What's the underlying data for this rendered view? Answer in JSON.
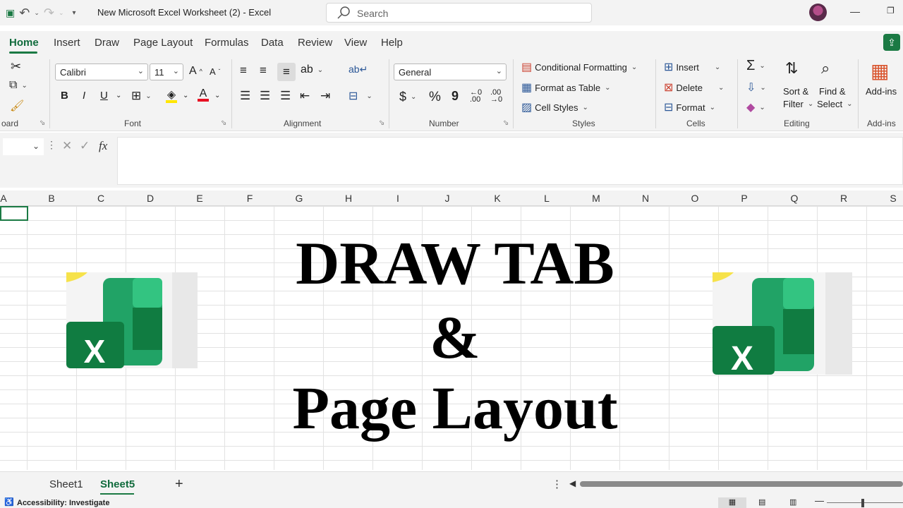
{
  "title_bar": {
    "document_title": "New Microsoft Excel Worksheet (2)  -  Excel",
    "search_placeholder": "Search",
    "undo_icon": "undo-icon",
    "redo_icon": "redo-icon"
  },
  "menu": {
    "tabs": [
      "Home",
      "Insert",
      "Draw",
      "Page Layout",
      "Formulas",
      "Data",
      "Review",
      "View",
      "Help"
    ],
    "active": "Home"
  },
  "ribbon": {
    "clipboard_label": "oard",
    "font": {
      "label": "Font",
      "font_name": "Calibri",
      "font_size": "11",
      "bold": "B",
      "italic": "I",
      "underline": "U"
    },
    "alignment_label": "Alignment",
    "number": {
      "label": "Number",
      "format": "General",
      "currency": "$",
      "percent": "%",
      "comma": "9"
    },
    "styles": {
      "label": "Styles",
      "conditional_formatting": "Conditional Formatting",
      "format_as_table": "Format as Table",
      "cell_styles": "Cell Styles"
    },
    "cells": {
      "label": "Cells",
      "insert": "Insert",
      "delete": "Delete",
      "format": "Format"
    },
    "editing": {
      "label": "Editing",
      "sort_filter_1": "Sort &",
      "sort_filter_2": "Filter",
      "find_select_1": "Find &",
      "find_select_2": "Select"
    },
    "addins": {
      "label": "Add-ins",
      "button": "Add-ins"
    }
  },
  "formula_bar": {
    "fx": "fx"
  },
  "columns": [
    "A",
    "B",
    "C",
    "D",
    "E",
    "F",
    "G",
    "H",
    "I",
    "J",
    "K",
    "L",
    "M",
    "N",
    "O",
    "P",
    "Q",
    "R",
    "S"
  ],
  "sheet_content": {
    "line1": "DRAW TAB",
    "line2": "&",
    "line3": "Page Layout"
  },
  "sheet_tabs": {
    "tabs": [
      "Sheet1",
      "Sheet5"
    ],
    "active": "Sheet5",
    "add": "+"
  },
  "status_bar": {
    "accessibility": "Accessibility: Investigate"
  },
  "colors": {
    "accent": "#1b7a44",
    "excel_dark": "#107c41",
    "excel_light": "#33c481"
  }
}
